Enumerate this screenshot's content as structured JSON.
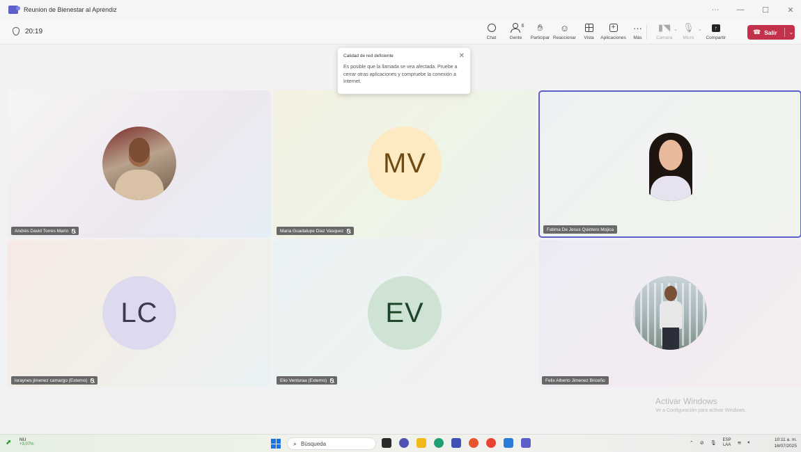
{
  "window": {
    "title": "Reunion de Bienestar al Aprendiz",
    "controls": [
      "···",
      "—",
      "☐",
      "✕"
    ]
  },
  "toolbar": {
    "timer": "20:19",
    "tools": [
      {
        "label": "Chat",
        "icon": "chat-icon"
      },
      {
        "label": "Gente",
        "icon": "people-icon",
        "count": "6"
      },
      {
        "label": "Participar",
        "icon": "raise-hand-icon"
      },
      {
        "label": "Reaccionar",
        "icon": "smiley-icon"
      },
      {
        "label": "Vista",
        "icon": "grid-view-icon"
      },
      {
        "label": "Aplicaciones",
        "icon": "apps-plus-icon"
      },
      {
        "label": "Más",
        "icon": "more-icon"
      }
    ],
    "devices": [
      {
        "label": "Cámara",
        "icon": "camera-off-icon",
        "disabled": true
      },
      {
        "label": "Micro",
        "icon": "mic-off-icon",
        "disabled": true
      },
      {
        "label": "Compartir",
        "icon": "share-icon"
      }
    ],
    "leave_label": "Salir"
  },
  "toast": {
    "title": "Calidad de red deficiente",
    "body": "Es posible que la llamada se vea afectada. Pruebe a cerrar otras aplicaciones y compruebe la conexión a Internet."
  },
  "participants": [
    {
      "name": "Andrés David Torres Marín",
      "initials": "",
      "muted": true
    },
    {
      "name": "Maria Guadalupe Diaz Vasquez",
      "initials": "MV",
      "muted": true
    },
    {
      "name": "Fatima De Jesus Quintero Mojica",
      "initials": "",
      "muted": false,
      "speaking": true
    },
    {
      "name": "loraynes jimenez camargo (Externo)",
      "initials": "LC",
      "muted": true
    },
    {
      "name": "Elio Venturaa (Externo)",
      "initials": "EV",
      "muted": true
    },
    {
      "name": "Felix Alberto Jimenez Briceño",
      "initials": "",
      "muted": false
    }
  ],
  "watermark": {
    "line1": "Activar Windows",
    "line2": "Ve a Configuración para activar Windows."
  },
  "taskbar": {
    "stock_name": "NU",
    "stock_change": "+3,07%",
    "search_placeholder": "Búsqueda",
    "lang_top": "ESP",
    "lang_bottom": "LAA",
    "time": "10:11 a. m.",
    "date": "16/07/2025"
  },
  "colors": {
    "accent": "#5b5fc7",
    "leave": "#c4314b"
  }
}
